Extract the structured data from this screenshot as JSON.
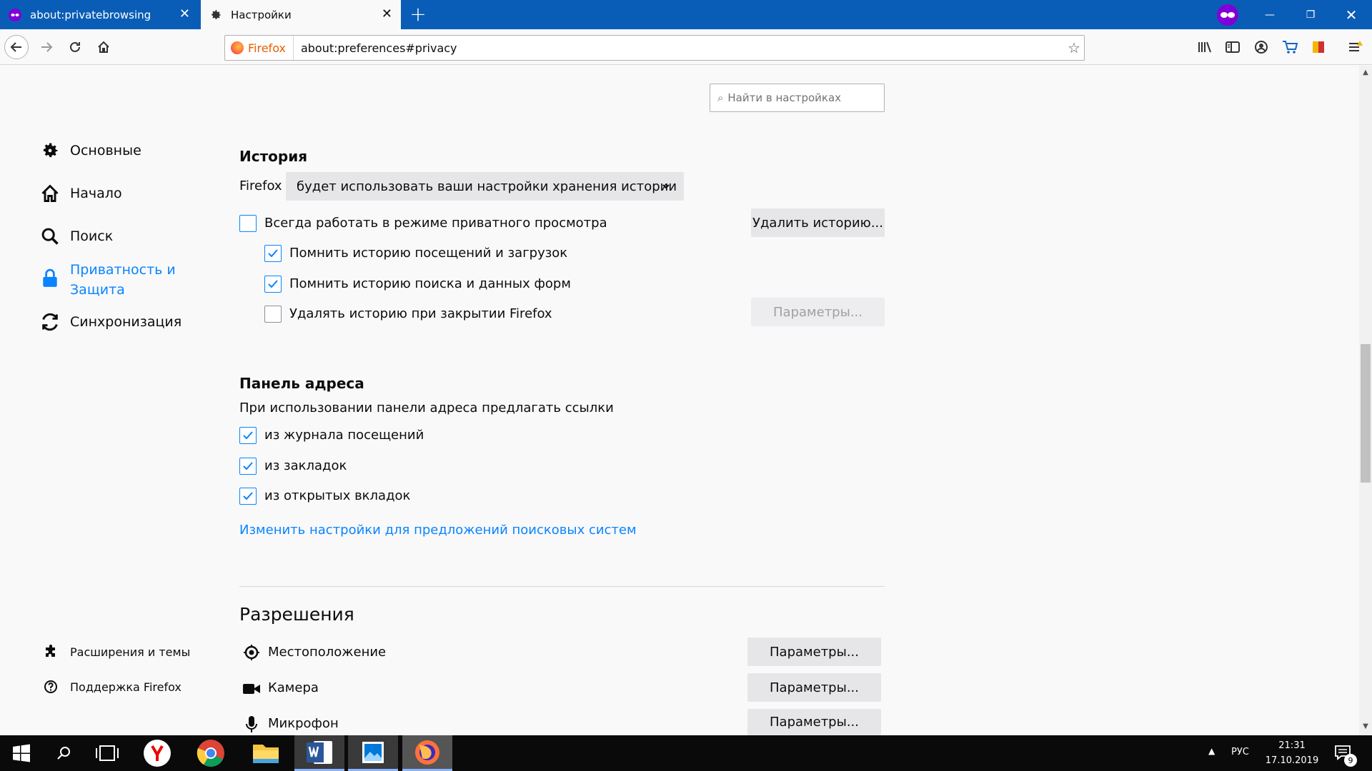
{
  "tabs": [
    {
      "label": "about:privatebrowsing",
      "icon": "mask-icon"
    },
    {
      "label": "Настройки",
      "icon": "gear-icon"
    }
  ],
  "toolbar": {
    "identity_label": "Firefox",
    "url": "about:preferences#privacy"
  },
  "search": {
    "placeholder": "Найти в настройках"
  },
  "sidebar": {
    "items": [
      {
        "label": "Основные",
        "icon": "gear-icon"
      },
      {
        "label": "Начало",
        "icon": "home-icon"
      },
      {
        "label": "Поиск",
        "icon": "search-icon"
      },
      {
        "label": "Приватность и Защита",
        "icon": "lock-icon",
        "selected": true
      },
      {
        "label": "Синхронизация",
        "icon": "sync-icon"
      }
    ],
    "footer": [
      {
        "label": "Расширения и темы",
        "icon": "puzzle-icon"
      },
      {
        "label": "Поддержка Firefox",
        "icon": "help-icon"
      }
    ]
  },
  "history": {
    "title": "История",
    "prefix": "Firefox",
    "mode_selected": "будет использовать ваши настройки хранения истории",
    "always_private": {
      "label": "Всегда работать в режиме приватного просмотра",
      "checked": false
    },
    "remember_visits": {
      "label": "Помнить историю посещений и загрузок",
      "checked": true
    },
    "remember_search": {
      "label": "Помнить историю поиска и данных форм",
      "checked": true
    },
    "clear_on_close": {
      "label": "Удалять историю при закрытии Firefox",
      "checked": false
    },
    "clear_button": "Удалить историю...",
    "settings_button": "Параметры..."
  },
  "address_bar": {
    "title": "Панель адреса",
    "description": "При использовании панели адреса предлагать ссылки",
    "options": [
      {
        "label": "из журнала посещений",
        "checked": true
      },
      {
        "label": "из закладок",
        "checked": true
      },
      {
        "label": "из открытых вкладок",
        "checked": true
      }
    ],
    "link": "Изменить настройки для предложений поисковых систем"
  },
  "permissions": {
    "title": "Разрешения",
    "items": [
      {
        "label": "Местоположение",
        "icon": "location-icon",
        "button": "Параметры..."
      },
      {
        "label": "Камера",
        "icon": "camera-icon",
        "button": "Параметры..."
      },
      {
        "label": "Микрофон",
        "icon": "microphone-icon",
        "button": "Параметры..."
      }
    ]
  },
  "taskbar": {
    "language": "РУС",
    "time": "21:31",
    "date": "17.10.2019",
    "notifications": "9"
  },
  "colors": {
    "titlebar": "#0a5db6",
    "accent": "#0a84ff",
    "private": "#8000d7"
  }
}
